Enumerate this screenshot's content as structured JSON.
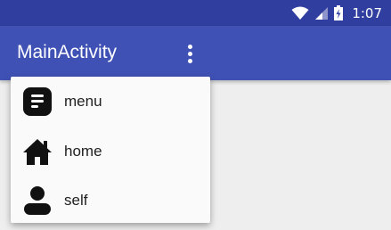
{
  "status_bar": {
    "time": "1:07",
    "icons": [
      "wifi-icon",
      "signal-icon",
      "battery-charging-icon"
    ]
  },
  "app_bar": {
    "title": "MainActivity",
    "overflow_icon": "more-vert-icon"
  },
  "menu": {
    "items": [
      {
        "label": "menu",
        "icon": "menu-list-icon"
      },
      {
        "label": "home",
        "icon": "home-icon"
      },
      {
        "label": "self",
        "icon": "person-icon"
      }
    ]
  },
  "colors": {
    "status_bar": "#303f9f",
    "app_bar": "#3f51b5",
    "background": "#eeeeee",
    "menu_background": "#fafafa"
  }
}
